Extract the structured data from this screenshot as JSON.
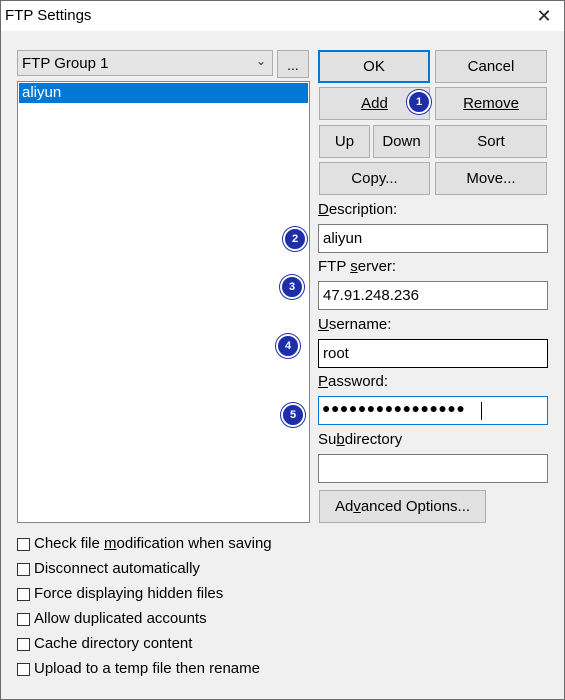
{
  "window": {
    "title": "FTP Settings",
    "close": "✕"
  },
  "group": {
    "selected": "FTP Group 1",
    "more_label": "..."
  },
  "accounts": [
    "aliyun"
  ],
  "buttons": {
    "ok": "OK",
    "cancel": "Cancel",
    "add": "Add",
    "remove": "Remove",
    "up": "Up",
    "down": "Down",
    "sort": "Sort",
    "copy": "Copy...",
    "move": "Move...",
    "advanced_pre": "Ad",
    "advanced_key": "v",
    "advanced_post": "anced Options..."
  },
  "fields": {
    "description": {
      "label_key": "D",
      "label_rest": "escription:",
      "value": "aliyun"
    },
    "ftp_server": {
      "label_pre": "FTP ",
      "label_key": "s",
      "label_rest": "erver:",
      "value": "47.91.248.236"
    },
    "username": {
      "label_key": "U",
      "label_rest": "sername:",
      "value": "root"
    },
    "password": {
      "label_key": "P",
      "label_rest": "assword:",
      "value": "●●●●●●●●●●●●●●●●"
    },
    "subdirectory": {
      "label_pre": "Su",
      "label_key": "b",
      "label_rest": "directory",
      "value": ""
    }
  },
  "badges": [
    "1",
    "2",
    "3",
    "4",
    "5"
  ],
  "options": {
    "check_mod_pre": "Check file ",
    "check_mod_key": "m",
    "check_mod_post": "odification when saving",
    "disconnect": "Disconnect automatically",
    "hidden": "Force displaying hidden files",
    "duplicated": "Allow duplicated accounts",
    "cache": "Cache directory content",
    "temp": "Upload to a temp file then rename"
  }
}
